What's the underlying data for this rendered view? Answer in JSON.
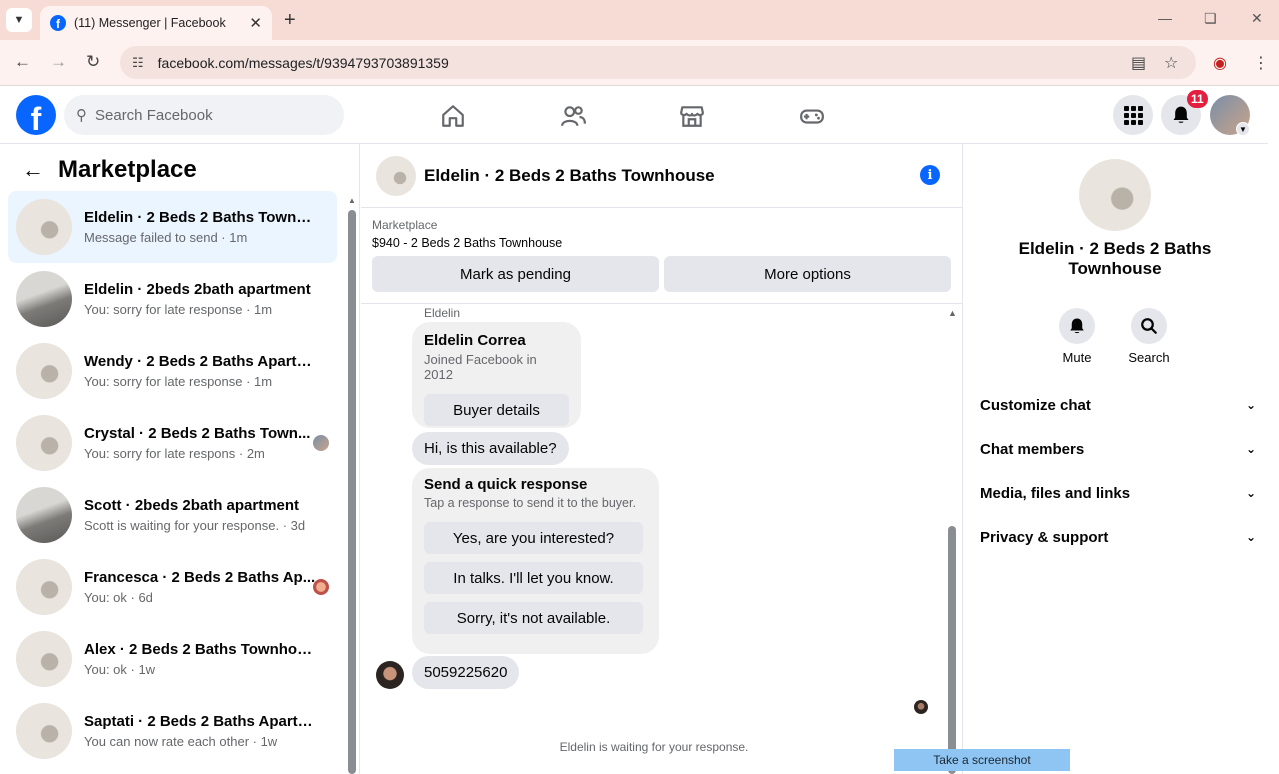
{
  "browser": {
    "tab_title": "(11) Messenger | Facebook",
    "url": "facebook.com/messages/t/9394793703891359"
  },
  "facebook": {
    "search_placeholder": "Search Facebook",
    "notification_count": "11"
  },
  "sidebar": {
    "title": "Marketplace",
    "conversations": [
      {
        "name": "Eldelin · 2 Beds 2 Baths Townho...",
        "preview": "Message failed to send · 1m",
        "active": true
      },
      {
        "name": "Eldelin · 2beds 2bath apartment",
        "preview": "You: sorry for late response · 1m"
      },
      {
        "name": "Wendy · 2 Beds 2 Baths Apartm...",
        "preview": "You: sorry for late response · 1m"
      },
      {
        "name": "Crystal · 2 Beds 2 Baths Town...",
        "preview": "You: sorry for late respons · 2m"
      },
      {
        "name": "Scott · 2beds 2bath apartment",
        "preview": "Scott is waiting for your response. · 3d"
      },
      {
        "name": "Francesca · 2 Beds 2 Baths Ap...",
        "preview": "You: ok · 6d"
      },
      {
        "name": "Alex · 2 Beds 2 Baths Townhouse",
        "preview": "You: ok · 1w"
      },
      {
        "name": "Saptati · 2 Beds 2 Baths Apartm...",
        "preview": "You can now rate each other · 1w"
      }
    ]
  },
  "chat": {
    "title": "Eldelin · 2 Beds 2 Baths Townhouse",
    "listing_label": "Marketplace",
    "listing_price": "$940 - 2 Beds 2 Baths Townhouse",
    "mark_pending": "Mark as pending",
    "more_options": "More options",
    "sender_label": "Eldelin",
    "buyer_name": "Eldelin Correa",
    "buyer_joined": "Joined Facebook in 2012",
    "buyer_details": "Buyer details",
    "message_1": "Hi, is this available?",
    "quick_title": "Send a quick response",
    "quick_sub": "Tap a response to send it to the buyer.",
    "quick_options": [
      "Yes, are you interested?",
      "In talks. I'll let you know.",
      "Sorry, it's not available."
    ],
    "message_2": "5059225620",
    "waiting": "Eldelin is waiting for your response.",
    "screenshot_tip": "Take a screenshot"
  },
  "details": {
    "name": "Eldelin · 2 Beds 2 Baths Townhouse",
    "mute": "Mute",
    "search": "Search",
    "sections": [
      "Customize chat",
      "Chat members",
      "Media, files and links",
      "Privacy & support"
    ]
  },
  "colors": {
    "brand": "#0866ff",
    "badge": "#e41e3f",
    "active_row": "#ebf5ff"
  }
}
